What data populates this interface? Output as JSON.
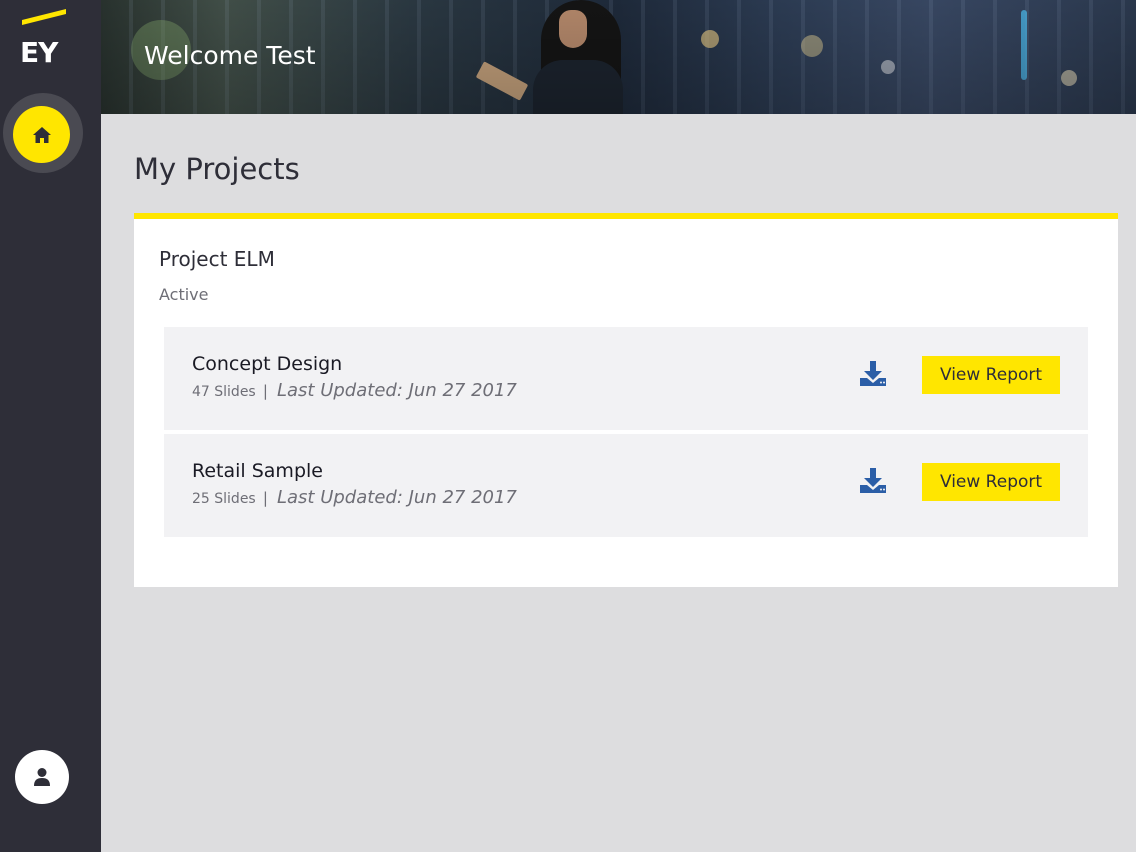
{
  "brand": {
    "logo_text": "EY",
    "accent_color": "#ffe600",
    "sidebar_color": "#2e2e38"
  },
  "header": {
    "title": "Welcome Test"
  },
  "sidebar": {
    "home_icon": "home-icon",
    "user_icon": "user-icon"
  },
  "main": {
    "title": "My Projects",
    "project": {
      "name": "Project ELM",
      "status": "Active",
      "reports": [
        {
          "name": "Concept Design",
          "slides": "47 Slides",
          "separator": "|",
          "updated": "Last Updated: Jun 27 2017",
          "download_icon": "download-icon",
          "view_label": "View Report"
        },
        {
          "name": "Retail Sample",
          "slides": "25 Slides",
          "separator": "|",
          "updated": "Last Updated: Jun 27 2017",
          "download_icon": "download-icon",
          "view_label": "View Report"
        }
      ]
    }
  }
}
